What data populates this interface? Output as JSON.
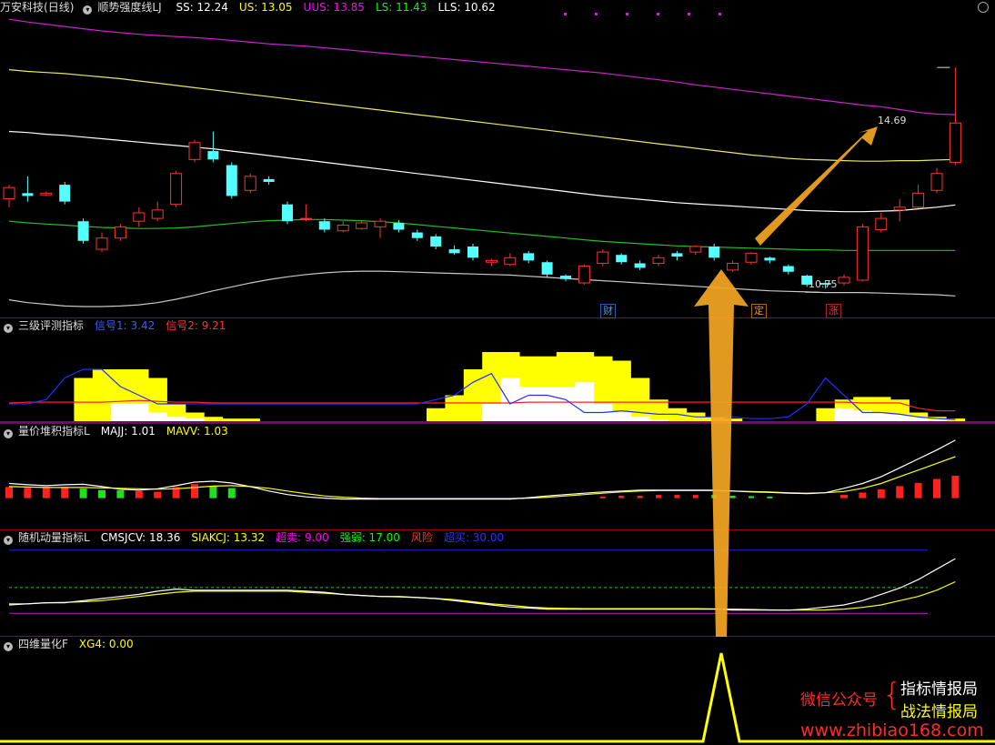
{
  "main": {
    "stock_name": "万安科技",
    "period": "(日线)",
    "indicator_name": "顺势强度线LJ",
    "readouts": [
      {
        "label": "SS: 12.24",
        "color": "#ffffff"
      },
      {
        "label": "US: 13.05",
        "color": "#ffff00"
      },
      {
        "label": "UUS: 13.85",
        "color": "#ff00ff"
      },
      {
        "label": "LS: 11.43",
        "color": "#00ff00"
      },
      {
        "label": "LLS: 10.62",
        "color": "#ffffff"
      }
    ],
    "high_label": "14.69",
    "low_label": "10.75",
    "tags": [
      {
        "text": "财",
        "color": "#4a9bff"
      },
      {
        "text": "定",
        "color": "#ff8c00"
      },
      {
        "text": "涨",
        "color": "#ff3030"
      }
    ]
  },
  "panel1": {
    "name": "三级评测指标",
    "readouts": [
      {
        "label": "信号1: 3.42",
        "color": "#3b5bff"
      },
      {
        "label": "信号2: 9.21",
        "color": "#ff3030"
      }
    ]
  },
  "panel2": {
    "name": "量价堆积指标L",
    "readouts": [
      {
        "label": "MAJJ: 1.01",
        "color": "#ffffff"
      },
      {
        "label": "MAVV: 1.03",
        "color": "#ffff00"
      }
    ]
  },
  "panel3": {
    "name": "随机动量指标L",
    "readouts": [
      {
        "label": "CMSJCV: 18.36",
        "color": "#ffffff"
      },
      {
        "label": "SIAKCJ: 13.32",
        "color": "#ffff00"
      },
      {
        "label": "超卖: 9.00",
        "color": "#ff00ff"
      },
      {
        "label": "强弱: 17.00",
        "color": "#00ff00"
      },
      {
        "label": "风险",
        "color": "#ff3030"
      },
      {
        "label": "超买: 30.00",
        "color": "#3030ff"
      }
    ]
  },
  "panel4": {
    "name": "四维量化F",
    "readouts": [
      {
        "label": "XG4: 0.00",
        "color": "#ffff00"
      }
    ]
  },
  "watermark": {
    "line1": "微信公众号",
    "line2a": "指标情报局",
    "line2b": "战法情报局",
    "url": "www.zhibiao168.com"
  },
  "chart_data": [
    {
      "type": "candlestick",
      "ylim": [
        10.3,
        15.6
      ],
      "candles": [
        [
          12.35,
          12.55,
          12.2,
          12.6
        ],
        [
          12.45,
          12.4,
          12.3,
          12.75
        ],
        [
          12.42,
          12.45,
          12.4,
          12.48
        ],
        [
          12.6,
          12.3,
          12.25,
          12.65
        ],
        [
          11.95,
          11.6,
          11.55,
          12.0
        ],
        [
          11.45,
          11.65,
          11.4,
          11.75
        ],
        [
          11.65,
          11.85,
          11.6,
          11.9
        ],
        [
          11.95,
          12.1,
          11.85,
          12.2
        ],
        [
          12.0,
          12.15,
          11.95,
          12.3
        ],
        [
          12.25,
          12.8,
          12.2,
          12.85
        ],
        [
          13.05,
          13.35,
          13.0,
          13.4
        ],
        [
          13.2,
          13.05,
          13.0,
          13.55
        ],
        [
          12.95,
          12.4,
          12.35,
          13.0
        ],
        [
          12.5,
          12.75,
          12.45,
          12.8
        ],
        [
          12.7,
          12.65,
          12.6,
          12.75
        ],
        [
          12.25,
          11.95,
          11.9,
          12.3
        ],
        [
          12.0,
          12.0,
          11.95,
          12.25
        ],
        [
          11.95,
          11.8,
          11.75,
          12.0
        ],
        [
          11.78,
          11.88,
          11.75,
          11.95
        ],
        [
          11.82,
          11.92,
          11.8,
          11.95
        ],
        [
          11.85,
          11.95,
          11.65,
          12.0
        ],
        [
          11.92,
          11.8,
          11.75,
          11.97
        ],
        [
          11.75,
          11.65,
          11.6,
          11.8
        ],
        [
          11.68,
          11.5,
          11.45,
          11.72
        ],
        [
          11.45,
          11.38,
          11.35,
          11.52
        ],
        [
          11.5,
          11.3,
          11.25,
          11.55
        ],
        [
          11.22,
          11.25,
          11.15,
          11.28
        ],
        [
          11.18,
          11.3,
          11.15,
          11.38
        ],
        [
          11.38,
          11.25,
          11.2,
          11.42
        ],
        [
          11.22,
          11.0,
          10.95,
          11.25
        ],
        [
          10.98,
          10.92,
          10.88,
          11.0
        ],
        [
          10.85,
          11.15,
          10.82,
          11.18
        ],
        [
          11.2,
          11.4,
          11.15,
          11.45
        ],
        [
          11.35,
          11.22,
          11.18,
          11.38
        ],
        [
          11.2,
          11.12,
          11.08,
          11.25
        ],
        [
          11.2,
          11.3,
          11.15,
          11.35
        ],
        [
          11.38,
          11.32,
          11.25,
          11.42
        ],
        [
          11.4,
          11.5,
          11.35,
          11.52
        ],
        [
          11.5,
          11.3,
          11.25,
          11.55
        ],
        [
          11.08,
          11.2,
          11.05,
          11.25
        ],
        [
          11.22,
          11.38,
          11.18,
          11.4
        ],
        [
          11.3,
          11.25,
          11.2,
          11.32
        ],
        [
          11.15,
          11.05,
          11.0,
          11.18
        ],
        [
          10.98,
          10.82,
          10.78,
          11.0
        ],
        [
          10.85,
          10.82,
          10.75,
          10.9
        ],
        [
          10.85,
          10.95,
          10.8,
          11.0
        ],
        [
          10.9,
          11.85,
          10.88,
          11.9
        ],
        [
          11.8,
          12.0,
          11.75,
          12.1
        ],
        [
          12.15,
          12.2,
          11.95,
          12.35
        ],
        [
          12.2,
          12.45,
          12.18,
          12.6
        ],
        [
          12.5,
          12.8,
          12.45,
          12.9
        ],
        [
          13.0,
          13.7,
          12.95,
          14.69
        ]
      ],
      "bands": {
        "UUS": [
          15.55,
          15.5,
          15.46,
          15.42,
          15.38,
          15.34,
          15.31,
          15.28,
          15.26,
          15.24,
          15.22,
          15.2,
          15.17,
          15.14,
          15.11,
          15.09,
          15.07,
          15.04,
          15.01,
          14.98,
          14.95,
          14.92,
          14.89,
          14.86,
          14.83,
          14.8,
          14.77,
          14.74,
          14.71,
          14.68,
          14.65,
          14.62,
          14.59,
          14.55,
          14.51,
          14.47,
          14.43,
          14.38,
          14.34,
          14.3,
          14.26,
          14.22,
          14.18,
          14.14,
          14.1,
          14.06,
          14.02,
          13.99,
          13.94,
          13.89,
          13.86,
          13.85
        ],
        "US": [
          14.65,
          14.62,
          14.6,
          14.58,
          14.55,
          14.52,
          14.49,
          14.45,
          14.41,
          14.37,
          14.33,
          14.29,
          14.25,
          14.21,
          14.17,
          14.13,
          14.09,
          14.05,
          14.01,
          13.97,
          13.93,
          13.89,
          13.85,
          13.81,
          13.77,
          13.73,
          13.69,
          13.65,
          13.61,
          13.57,
          13.53,
          13.49,
          13.45,
          13.41,
          13.37,
          13.33,
          13.29,
          13.25,
          13.21,
          13.17,
          13.13,
          13.1,
          13.07,
          13.05,
          13.04,
          13.03,
          13.02,
          13.02,
          13.03,
          13.03,
          13.04,
          13.05
        ],
        "SS": [
          13.55,
          13.53,
          13.5,
          13.48,
          13.45,
          13.42,
          13.39,
          13.36,
          13.33,
          13.3,
          13.27,
          13.24,
          13.2,
          13.16,
          13.12,
          13.08,
          13.04,
          13.0,
          12.96,
          12.92,
          12.88,
          12.84,
          12.8,
          12.76,
          12.72,
          12.68,
          12.64,
          12.6,
          12.56,
          12.52,
          12.48,
          12.44,
          12.4,
          12.37,
          12.34,
          12.31,
          12.28,
          12.26,
          12.24,
          12.22,
          12.2,
          12.18,
          12.16,
          12.14,
          12.13,
          12.12,
          12.12,
          12.13,
          12.14,
          12.17,
          12.2,
          12.24
        ],
        "LS": [
          11.95,
          11.92,
          11.9,
          11.88,
          11.86,
          11.84,
          11.83,
          11.82,
          11.82,
          11.83,
          11.85,
          11.88,
          11.91,
          11.94,
          11.96,
          11.97,
          11.98,
          11.98,
          11.97,
          11.96,
          11.94,
          11.92,
          11.89,
          11.86,
          11.83,
          11.8,
          11.77,
          11.74,
          11.71,
          11.68,
          11.65,
          11.62,
          11.59,
          11.57,
          11.55,
          11.53,
          11.51,
          11.5,
          11.49,
          11.48,
          11.47,
          11.46,
          11.45,
          11.44,
          11.44,
          11.43,
          11.43,
          11.43,
          11.43,
          11.43,
          11.43,
          11.43
        ],
        "LLS": [
          10.55,
          10.5,
          10.47,
          10.44,
          10.43,
          10.43,
          10.44,
          10.46,
          10.5,
          10.56,
          10.63,
          10.71,
          10.78,
          10.85,
          10.91,
          10.96,
          11.0,
          11.03,
          11.05,
          11.06,
          11.06,
          11.05,
          11.04,
          11.03,
          11.02,
          11.01,
          11.0,
          10.99,
          10.97,
          10.95,
          10.93,
          10.91,
          10.89,
          10.87,
          10.85,
          10.83,
          10.81,
          10.79,
          10.77,
          10.75,
          10.73,
          10.71,
          10.7,
          10.69,
          10.68,
          10.68,
          10.68,
          10.67,
          10.66,
          10.65,
          10.64,
          10.62
        ]
      }
    },
    {
      "type": "area",
      "name": "三级评测",
      "ylim": [
        0,
        10
      ],
      "yellow": [
        0,
        0,
        0,
        0,
        5,
        6,
        6,
        6,
        5,
        2,
        1,
        0.5,
        0.3,
        0.3,
        0,
        0,
        0,
        0,
        0,
        0,
        0,
        0,
        0,
        1.5,
        3,
        6,
        8,
        8,
        7.5,
        7.5,
        8,
        8,
        7.5,
        7,
        5,
        2.5,
        1.5,
        1,
        0.5,
        0.3,
        0,
        0,
        0,
        0,
        1.5,
        2.5,
        2.8,
        2.8,
        2.5,
        1,
        0.5,
        0.3
      ],
      "white": [
        0,
        0,
        0,
        0,
        0,
        0,
        2,
        2,
        1,
        0.5,
        0.3,
        0,
        0,
        0,
        0,
        0,
        0,
        0,
        0,
        0,
        0,
        0,
        0,
        0,
        0,
        0,
        2,
        5,
        4,
        4,
        4,
        4.5,
        2,
        1,
        0.5,
        0.2,
        0,
        0,
        0,
        0,
        0,
        0,
        0,
        0,
        0,
        1.5,
        1.2,
        1,
        0.8,
        0.5,
        0.2,
        0
      ],
      "blue": [
        2,
        2,
        2.5,
        5,
        6,
        6,
        4,
        3,
        2,
        2,
        2,
        2,
        2,
        2,
        2,
        2,
        2,
        2,
        2,
        2,
        2,
        2,
        2,
        2.5,
        3,
        4.5,
        5.5,
        2,
        3,
        3,
        2.5,
        1,
        1,
        1.2,
        1,
        0.8,
        0.8,
        0.5,
        0.5,
        0.5,
        0.3,
        0.3,
        0.5,
        2,
        5,
        3,
        1,
        1,
        0.8,
        0.5,
        0.3,
        0.2
      ],
      "red": [
        2.1,
        2.2,
        2.2,
        2.2,
        2.2,
        2.2,
        2.3,
        2.4,
        2.3,
        2.2,
        2.2,
        2.1,
        2.1,
        2.1,
        2.1,
        2.1,
        2.1,
        2.1,
        2.1,
        2.1,
        2.1,
        2.1,
        2.1,
        2.1,
        2.1,
        2.1,
        2.1,
        2.1,
        2.2,
        2.2,
        2.2,
        2.2,
        2.2,
        2.2,
        2.2,
        2.2,
        2.2,
        2.2,
        2.2,
        2.2,
        2.2,
        2.2,
        2.2,
        2.2,
        2.2,
        2.2,
        2.1,
        2.1,
        2.1,
        1.5,
        1.2,
        1.2
      ]
    },
    {
      "type": "bar",
      "name": "量价堆积",
      "ylim": [
        0,
        2
      ],
      "bars": [
        0.28,
        0.26,
        0.28,
        0.28,
        -0.24,
        -0.2,
        -0.2,
        0.18,
        0.16,
        0.28,
        0.35,
        -0.3,
        -0.25,
        0,
        0,
        0,
        0,
        0,
        0,
        0,
        0,
        0,
        0,
        0,
        0,
        0,
        0,
        0,
        0,
        0,
        0,
        0,
        0.04,
        0.06,
        0.06,
        0.08,
        0.08,
        0.08,
        -0.08,
        -0.06,
        -0.05,
        -0.04,
        0,
        0,
        0,
        0.08,
        0.14,
        0.22,
        0.3,
        0.38,
        0.48,
        0.56
      ],
      "MAJJ": [
        0.95,
        0.92,
        0.9,
        0.92,
        0.93,
        0.88,
        0.82,
        0.8,
        0.83,
        0.9,
        0.98,
        1.0,
        0.96,
        0.88,
        0.78,
        0.7,
        0.65,
        0.62,
        0.6,
        0.6,
        0.6,
        0.6,
        0.6,
        0.6,
        0.6,
        0.6,
        0.6,
        0.6,
        0.63,
        0.67,
        0.7,
        0.73,
        0.76,
        0.78,
        0.8,
        0.8,
        0.8,
        0.8,
        0.8,
        0.78,
        0.76,
        0.75,
        0.73,
        0.72,
        0.74,
        0.84,
        0.95,
        1.1,
        1.3,
        1.5,
        1.7,
        1.92
      ],
      "MAVV": [
        0.88,
        0.87,
        0.86,
        0.86,
        0.86,
        0.85,
        0.84,
        0.83,
        0.82,
        0.83,
        0.86,
        0.89,
        0.9,
        0.88,
        0.84,
        0.78,
        0.72,
        0.67,
        0.64,
        0.62,
        0.61,
        0.61,
        0.61,
        0.61,
        0.61,
        0.61,
        0.61,
        0.61,
        0.62,
        0.64,
        0.67,
        0.7,
        0.73,
        0.76,
        0.78,
        0.79,
        0.79,
        0.79,
        0.79,
        0.78,
        0.77,
        0.76,
        0.74,
        0.73,
        0.74,
        0.77,
        0.84,
        0.95,
        1.1,
        1.25,
        1.4,
        1.55
      ]
    },
    {
      "type": "line",
      "name": "随机动量",
      "ylim": [
        0,
        45
      ],
      "CMSJCV": [
        13,
        13.5,
        14,
        14,
        15,
        16,
        17,
        18,
        19.5,
        20.5,
        20,
        20,
        20,
        20,
        20,
        20,
        19.5,
        19,
        18,
        17.5,
        17,
        17,
        16.5,
        16,
        15,
        14,
        13,
        12,
        11.5,
        11,
        11,
        11,
        11,
        11,
        11,
        11,
        11,
        11,
        11,
        10.5,
        10.5,
        10.5,
        10.5,
        11,
        12,
        13,
        15,
        18,
        21,
        25,
        30,
        35
      ],
      "SIAKCJ": [
        13.5,
        13.5,
        14,
        14.2,
        14.5,
        15,
        16,
        17,
        18,
        19,
        19.5,
        19.5,
        19.5,
        19.5,
        19.5,
        19.5,
        19,
        18.5,
        18,
        17.5,
        17,
        16.8,
        16.5,
        16,
        15.5,
        14.5,
        13.5,
        12.8,
        12,
        11.5,
        11.3,
        11.2,
        11.2,
        11.2,
        11.2,
        11.2,
        11.2,
        11.2,
        11.1,
        11,
        10.8,
        10.6,
        10.5,
        10.5,
        10.6,
        11,
        11.8,
        13,
        15,
        17,
        20,
        24
      ],
      "超卖": 9.0,
      "强弱": 17.0,
      "超买": 30.0
    },
    {
      "type": "line",
      "name": "四维量化F",
      "ylim": [
        0,
        1
      ],
      "XG4": [
        0,
        0,
        0,
        0,
        0,
        0,
        0,
        0,
        0,
        0,
        0,
        0,
        0,
        0,
        0,
        0,
        0,
        0,
        0,
        0,
        0,
        0,
        0,
        0,
        0,
        0,
        0,
        0,
        0,
        0,
        0,
        0,
        0,
        0,
        0,
        0,
        0,
        0,
        0,
        1,
        0,
        0,
        0,
        0,
        0,
        0,
        0,
        0,
        0,
        0,
        0,
        0
      ]
    }
  ]
}
